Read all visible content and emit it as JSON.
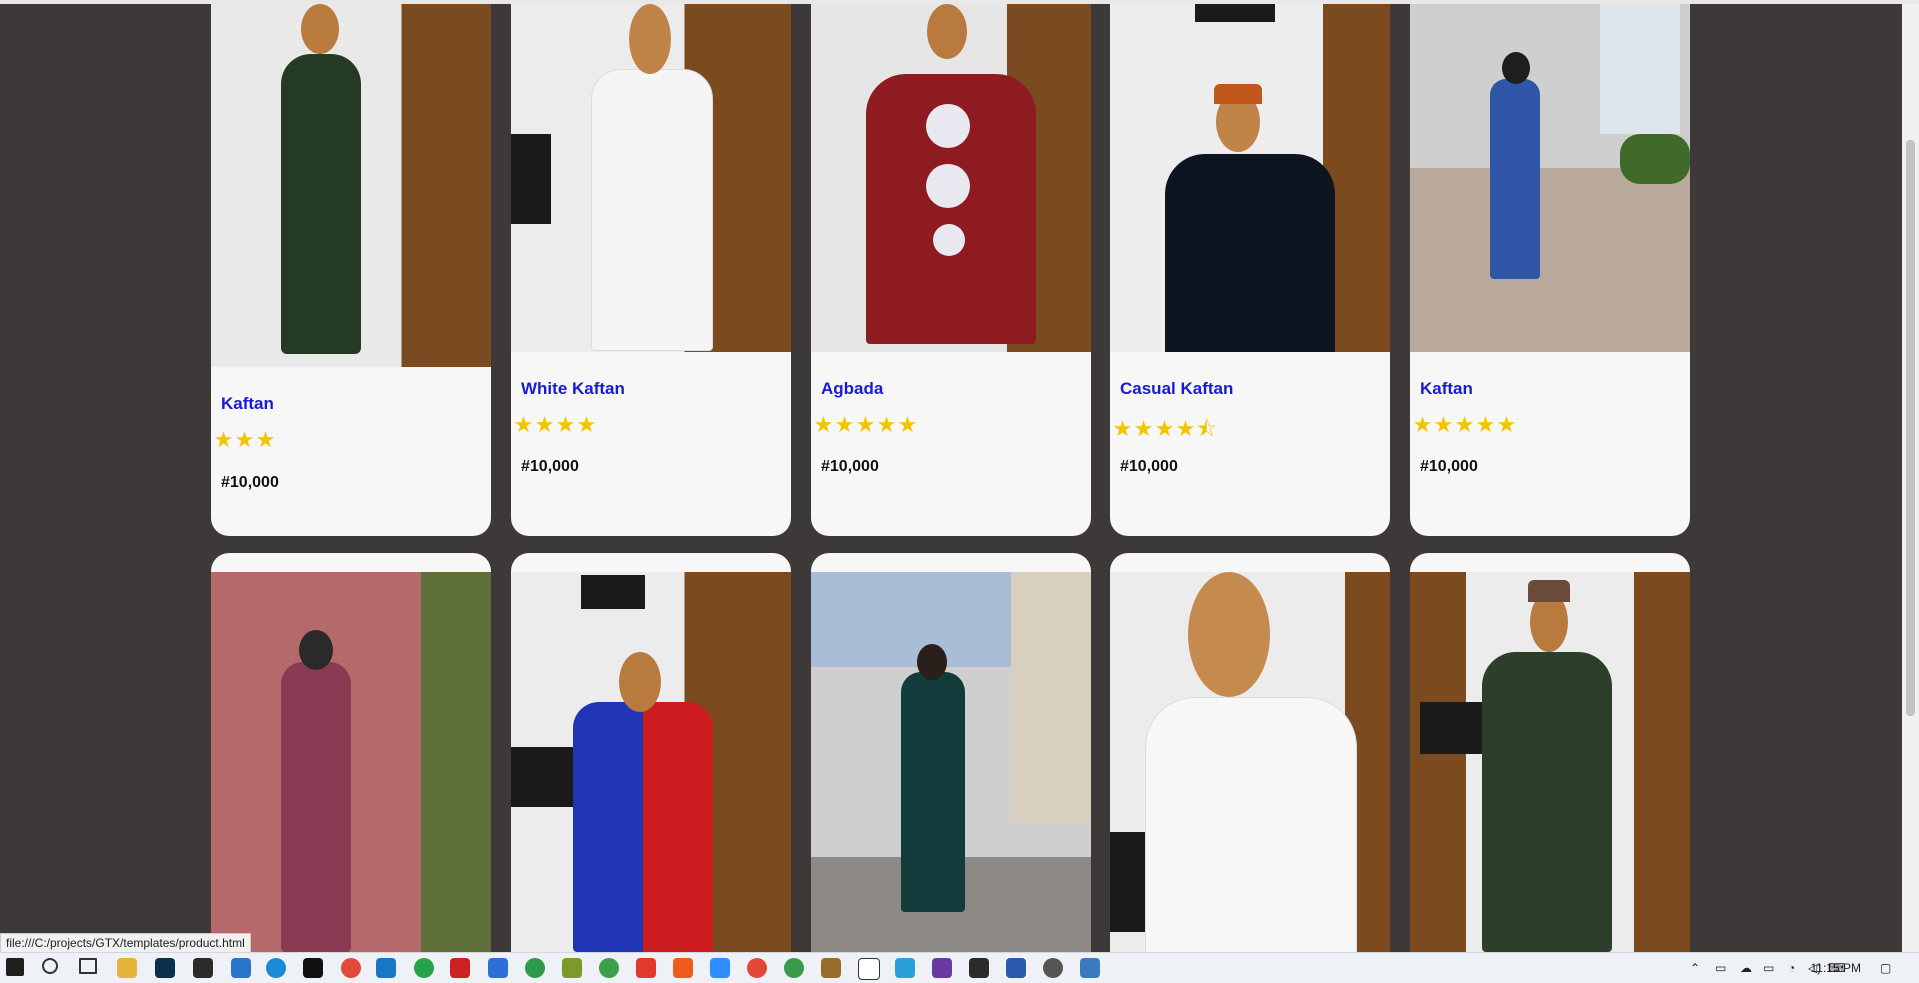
{
  "products": [
    {
      "name": "Kaftan",
      "stars": "★★★",
      "price": "#10,000"
    },
    {
      "name": "White Kaftan",
      "stars": "★★★★",
      "price": "#10,000"
    },
    {
      "name": "Agbada",
      "stars": "★★★★★",
      "price": "#10,000"
    },
    {
      "name": "Casual Kaftan",
      "stars": "★★★★⯪",
      "price": "#10,000"
    },
    {
      "name": "Kaftan",
      "stars": "★★★★★",
      "price": "#10,000"
    }
  ],
  "status_url": "file:///C:/projects/GTX/templates/product.html",
  "clock": "11:15 PM",
  "colors": {
    "page_bg": "#3e3939",
    "card_bg": "#f7f7f7",
    "name": "#1a1ad6",
    "star": "#f5c400"
  },
  "icons": {
    "star": "star-icon",
    "half_star": "half-star-icon"
  }
}
